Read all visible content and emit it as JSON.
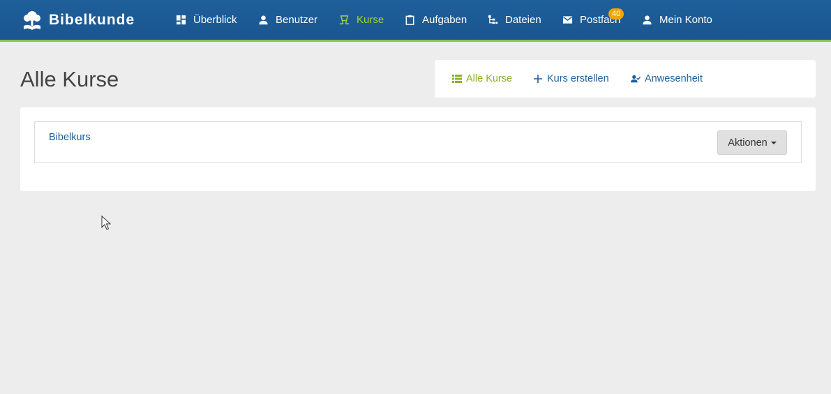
{
  "brand": {
    "name": "Bibelkunde",
    "icon": "tree-book-icon"
  },
  "nav": {
    "items": [
      {
        "label": "Überblick",
        "icon": "dashboard-icon",
        "active": false
      },
      {
        "label": "Benutzer",
        "icon": "user-icon",
        "active": false
      },
      {
        "label": "Kurse",
        "icon": "chalkboard-teacher-icon",
        "active": true
      },
      {
        "label": "Aufgaben",
        "icon": "clipboard-icon",
        "active": false
      },
      {
        "label": "Dateien",
        "icon": "file-tree-icon",
        "active": false
      },
      {
        "label": "Postfach",
        "icon": "mail-icon",
        "active": false,
        "badge": "40"
      },
      {
        "label": "Mein Konto",
        "icon": "user-icon",
        "active": false
      }
    ]
  },
  "page": {
    "title": "Alle Kurse"
  },
  "actions": {
    "items": [
      {
        "label": "Alle Kurse",
        "icon": "list-icon",
        "active": true
      },
      {
        "label": "Kurs erstellen",
        "icon": "plus-icon",
        "active": false
      },
      {
        "label": "Anwesenheit",
        "icon": "user-check-icon",
        "active": false
      }
    ]
  },
  "courses": [
    {
      "name": "Bibelkurs",
      "actions_label": "Aktionen"
    }
  ],
  "colors": {
    "nav_bg": "#1a5690",
    "accent_green": "#8bc34a",
    "active_link": "#a6cf3a",
    "link_blue": "#1f5f9a",
    "badge": "#f0a500"
  }
}
